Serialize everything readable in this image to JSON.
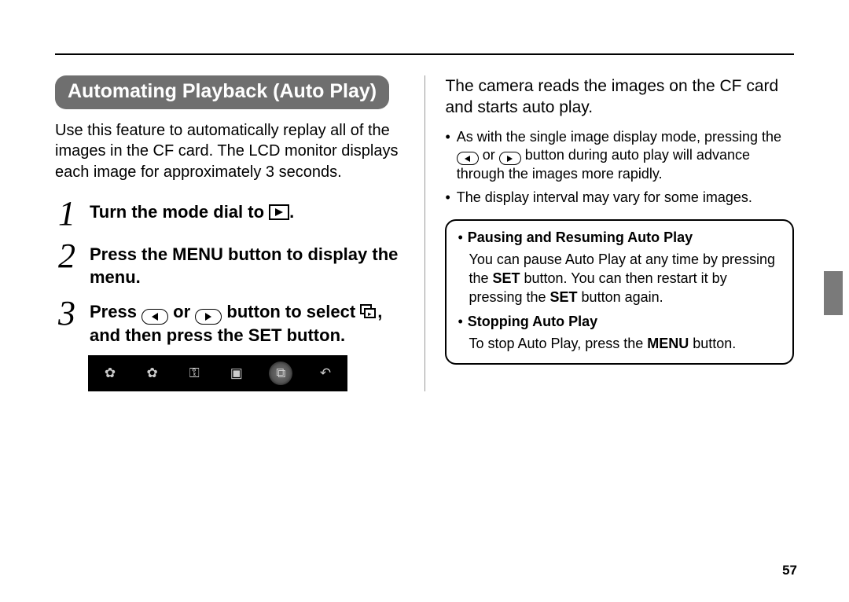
{
  "section_title": "Automating Playback (Auto Play)",
  "intro": "Use this feature to automatically replay all of the images in the CF card. The LCD monitor displays each image for approximately 3 seconds.",
  "steps": {
    "s1": {
      "num": "1",
      "a": "Turn the mode dial to ",
      "b": "."
    },
    "s2": {
      "num": "2",
      "text": "Press the MENU button to display the menu."
    },
    "s3": {
      "num": "3",
      "a": "Press  ",
      "b": "  or  ",
      "c": "  button to select ",
      "d": ", and then press the SET button."
    }
  },
  "right": {
    "intro": "The camera reads the images on the CF card and starts auto play.",
    "bullet1a": "As with the single image display mode, pressing the ",
    "bullet1b": " or ",
    "bullet1c": " button during auto play will advance through the images more rapidly.",
    "bullet2": "The display interval may vary for some images."
  },
  "box": {
    "t1": "Pausing and Resuming Auto Play",
    "p1a": "You can pause Auto Play at any time by pressing the ",
    "p1b": " button. You can then restart it by pressing the ",
    "p1c": " button again.",
    "set": "SET",
    "t2": "Stopping Auto Play",
    "p2a": "To stop Auto Play, press the ",
    "p2b": " button.",
    "menu": "MENU"
  },
  "page_number": "57"
}
